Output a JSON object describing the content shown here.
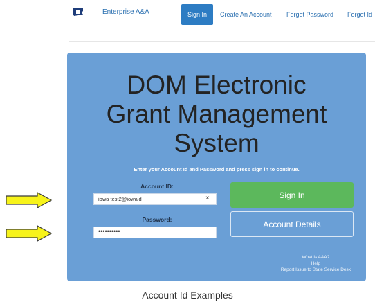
{
  "nav": {
    "brand": "Enterprise A&A",
    "signin": "Sign In",
    "create": "Create An Account",
    "forgot_password": "Forgot Password",
    "forgot_id": "Forgot Id"
  },
  "main": {
    "title_line1": "DOM Electronic",
    "title_line2": "Grant Management",
    "title_line3": "System",
    "instructions": "Enter your Account Id and Password and press sign in to continue.",
    "account_label": "Account ID:",
    "account_value": "iowa test2@iowaid",
    "clear": "×",
    "password_label": "Password:",
    "password_value": "••••••••••",
    "signin_button": "Sign In",
    "account_details_button": "Account Details",
    "links": [
      "What is A&A?",
      "Help",
      "Report Issue to State Service Desk"
    ]
  },
  "footer": {
    "examples_heading": "Account Id Examples"
  },
  "colors": {
    "panel": "#6a9fd6",
    "signin_green": "#5cb85c",
    "nav_active": "#2d7cc3",
    "arrow_fill": "#f7f31a"
  }
}
